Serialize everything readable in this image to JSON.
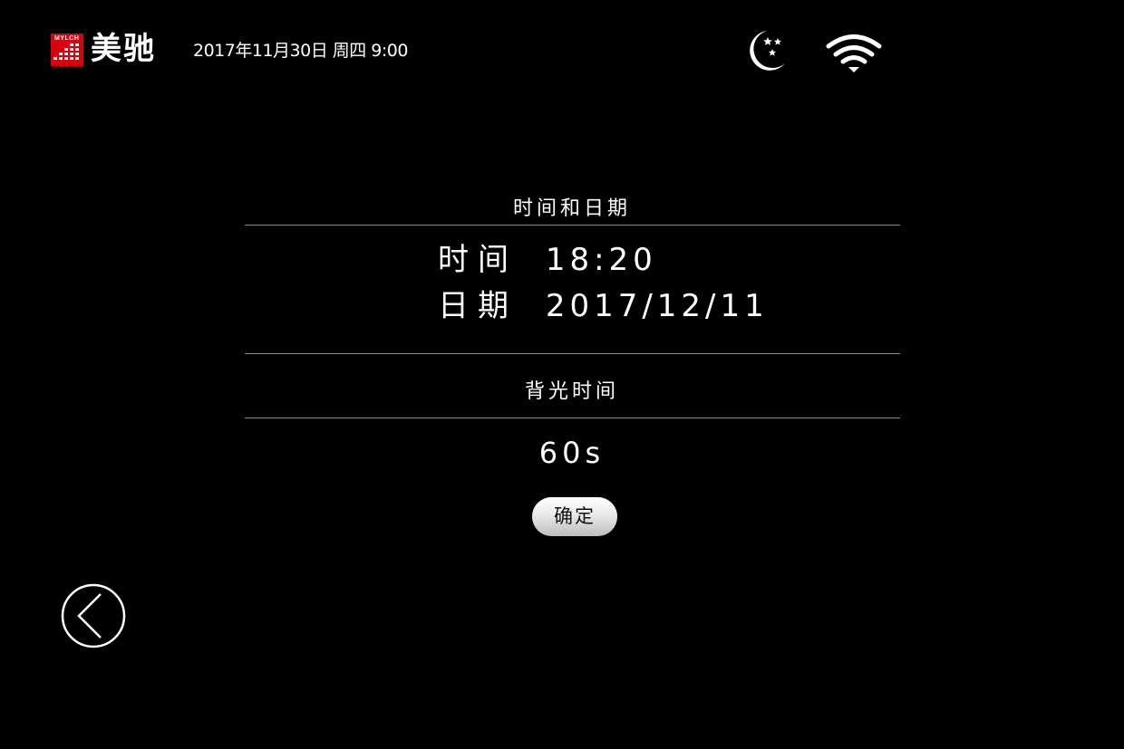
{
  "header": {
    "logo_small_text": "MYLCH",
    "brand_name": "美驰",
    "datetime": "2017年11月30日 周四 9:00",
    "icons": {
      "night_mode": "moon-stars-icon",
      "wifi": "wifi-icon"
    }
  },
  "time_date_section": {
    "title": "时间和日期",
    "time_label": "时间",
    "time_value": "18:20",
    "date_label": "日期",
    "date_value": "2017/12/11"
  },
  "backlight_section": {
    "title": "背光时间",
    "value": "60s"
  },
  "actions": {
    "confirm_label": "确定",
    "back_icon": "chevron-left-circle-icon"
  },
  "colors": {
    "background": "#000000",
    "brand_red": "#d7000f",
    "text": "#ffffff",
    "divider": "#8a8a8a"
  }
}
